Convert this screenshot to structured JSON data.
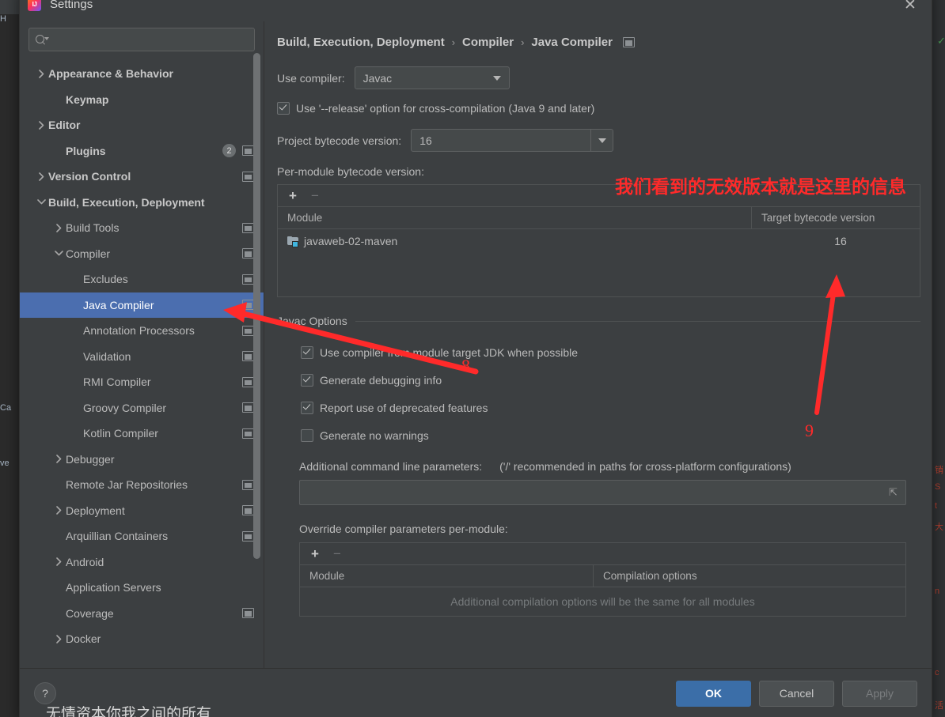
{
  "window": {
    "title": "Settings",
    "close_label": "✕",
    "app_icon": "intellij-idea-icon"
  },
  "search": {
    "value": "",
    "placeholder": ""
  },
  "sidebar": {
    "items": [
      {
        "label": "Appearance & Behavior",
        "indent": 0,
        "twisty": "right",
        "bold": true,
        "badge": null,
        "proj_icon": false,
        "selected": false
      },
      {
        "label": "Keymap",
        "indent": 1,
        "twisty": "none",
        "bold": true,
        "badge": null,
        "proj_icon": false,
        "selected": false
      },
      {
        "label": "Editor",
        "indent": 0,
        "twisty": "right",
        "bold": true,
        "badge": null,
        "proj_icon": false,
        "selected": false
      },
      {
        "label": "Plugins",
        "indent": 1,
        "twisty": "none",
        "bold": true,
        "badge": "2",
        "proj_icon": true,
        "selected": false
      },
      {
        "label": "Version Control",
        "indent": 0,
        "twisty": "right",
        "bold": true,
        "badge": null,
        "proj_icon": true,
        "selected": false
      },
      {
        "label": "Build, Execution, Deployment",
        "indent": 0,
        "twisty": "down",
        "bold": true,
        "badge": null,
        "proj_icon": false,
        "selected": false
      },
      {
        "label": "Build Tools",
        "indent": 1,
        "twisty": "right",
        "bold": false,
        "badge": null,
        "proj_icon": true,
        "selected": false
      },
      {
        "label": "Compiler",
        "indent": 1,
        "twisty": "down",
        "bold": false,
        "badge": null,
        "proj_icon": true,
        "selected": false
      },
      {
        "label": "Excludes",
        "indent": 2,
        "twisty": "none",
        "bold": false,
        "badge": null,
        "proj_icon": true,
        "selected": false
      },
      {
        "label": "Java Compiler",
        "indent": 2,
        "twisty": "none",
        "bold": false,
        "badge": null,
        "proj_icon": true,
        "selected": true
      },
      {
        "label": "Annotation Processors",
        "indent": 2,
        "twisty": "none",
        "bold": false,
        "badge": null,
        "proj_icon": true,
        "selected": false
      },
      {
        "label": "Validation",
        "indent": 2,
        "twisty": "none",
        "bold": false,
        "badge": null,
        "proj_icon": true,
        "selected": false
      },
      {
        "label": "RMI Compiler",
        "indent": 2,
        "twisty": "none",
        "bold": false,
        "badge": null,
        "proj_icon": true,
        "selected": false
      },
      {
        "label": "Groovy Compiler",
        "indent": 2,
        "twisty": "none",
        "bold": false,
        "badge": null,
        "proj_icon": true,
        "selected": false
      },
      {
        "label": "Kotlin Compiler",
        "indent": 2,
        "twisty": "none",
        "bold": false,
        "badge": null,
        "proj_icon": true,
        "selected": false
      },
      {
        "label": "Debugger",
        "indent": 1,
        "twisty": "right",
        "bold": false,
        "badge": null,
        "proj_icon": false,
        "selected": false
      },
      {
        "label": "Remote Jar Repositories",
        "indent": 1,
        "twisty": "none",
        "bold": false,
        "badge": null,
        "proj_icon": true,
        "selected": false
      },
      {
        "label": "Deployment",
        "indent": 1,
        "twisty": "right",
        "bold": false,
        "badge": null,
        "proj_icon": true,
        "selected": false
      },
      {
        "label": "Arquillian Containers",
        "indent": 1,
        "twisty": "none",
        "bold": false,
        "badge": null,
        "proj_icon": true,
        "selected": false
      },
      {
        "label": "Android",
        "indent": 1,
        "twisty": "right",
        "bold": false,
        "badge": null,
        "proj_icon": false,
        "selected": false
      },
      {
        "label": "Application Servers",
        "indent": 1,
        "twisty": "none",
        "bold": false,
        "badge": null,
        "proj_icon": false,
        "selected": false
      },
      {
        "label": "Coverage",
        "indent": 1,
        "twisty": "none",
        "bold": false,
        "badge": null,
        "proj_icon": true,
        "selected": false
      },
      {
        "label": "Docker",
        "indent": 1,
        "twisty": "right",
        "bold": false,
        "badge": null,
        "proj_icon": false,
        "selected": false
      }
    ]
  },
  "main": {
    "breadcrumb": {
      "part1": "Build, Execution, Deployment",
      "part2": "Compiler",
      "part3": "Java Compiler",
      "separator": "›"
    },
    "use_compiler": {
      "label": "Use compiler:",
      "value": "Javac"
    },
    "release_option": {
      "label": "Use '--release' option for cross-compilation (Java 9 and later)",
      "checked": true
    },
    "project_bytecode": {
      "label": "Project bytecode version:",
      "value": "16"
    },
    "per_module": {
      "label": "Per-module bytecode version:",
      "add_label": "+",
      "remove_label": "−",
      "columns": [
        "Module",
        "Target bytecode version"
      ],
      "rows": [
        {
          "module": "javaweb-02-maven",
          "target": "16"
        }
      ]
    },
    "javac_options": {
      "title": "Javac Options",
      "checkboxes": [
        {
          "label": "Use compiler from module target JDK when possible",
          "checked": true
        },
        {
          "label": "Generate debugging info",
          "checked": true
        },
        {
          "label": "Report use of deprecated features",
          "checked": true
        },
        {
          "label": "Generate no warnings",
          "checked": false
        }
      ],
      "additional_params": {
        "label": "Additional command line parameters:",
        "hint": "('/' recommended in paths for cross-platform configurations)",
        "value": ""
      },
      "override": {
        "label": "Override compiler parameters per-module:",
        "add_label": "+",
        "remove_label": "−",
        "columns": [
          "Module",
          "Compilation options"
        ],
        "empty_note": "Additional compilation options will be the same for all modules"
      }
    }
  },
  "footer": {
    "help_label": "?",
    "ok_label": "OK",
    "cancel_label": "Cancel",
    "apply_label": "Apply"
  },
  "annotations": {
    "color": "#ff2a2a",
    "note_cn": "我们看到的无效版本就是这里的信息",
    "marker_8": "8",
    "marker_9": "9"
  },
  "background": {
    "bottom_text": "无情资本你我之间的所有",
    "left_fragment_1": "H",
    "left_fragment_2": "Ca",
    "left_fragment_3": "ve",
    "right_fragment_1": "销",
    "right_fragment_2": "S",
    "right_fragment_3": "t",
    "right_fragment_4": "大",
    "right_fragment_5": "n",
    "right_fragment_6": "c",
    "right_fragment_7": "活"
  }
}
